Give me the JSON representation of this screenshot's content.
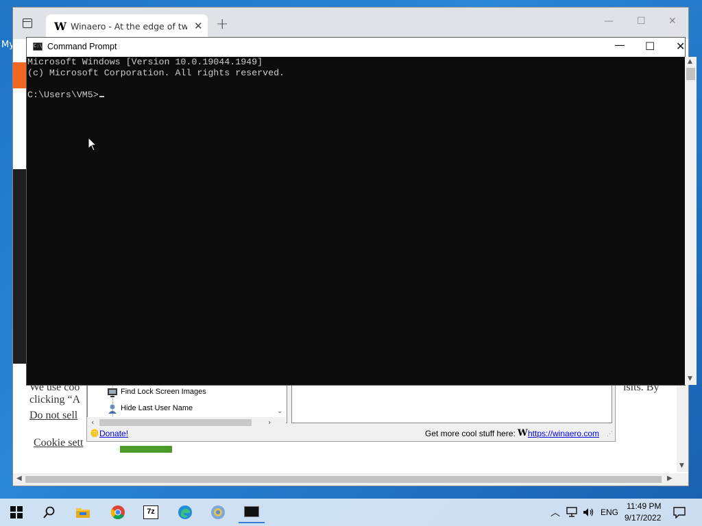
{
  "desktop": {
    "icon_label_partial": "My"
  },
  "browser": {
    "tab": {
      "title": "Winaero - At the edge of tweaki",
      "favicon_letter": "W"
    },
    "controls": {
      "minimize": "—",
      "maximize": "☐",
      "close": "✕",
      "new_tab": "+"
    },
    "page": {
      "cookie_line1_left": "We use coo",
      "cookie_line1_right": "isits. By",
      "cookie_line2": "clicking “A",
      "do_not_sell": "Do not sell",
      "cookie_settings": "Cookie sett"
    }
  },
  "tweaker": {
    "tree_items": [
      {
        "label": "Find Lock Screen Images",
        "icon": "monitor-icon"
      },
      {
        "label": "Hide Last User Name",
        "icon": "user-icon"
      }
    ],
    "status": {
      "donate": "Donate!",
      "more_text": "Get more cool stuff here:",
      "brand_letter": "W",
      "url": "https://winaero.com"
    }
  },
  "cmd": {
    "title": "Command Prompt",
    "lines": [
      "Microsoft Windows [Version 10.0.19044.1949]",
      "(c) Microsoft Corporation. All rights reserved.",
      "",
      "C:\\Users\\VM5>"
    ]
  },
  "taskbar": {
    "apps": [
      "start-icon",
      "search-icon",
      "file-explorer-icon",
      "chrome-icon",
      "7zip-icon",
      "edge-icon",
      "chromium-icon",
      "cmd-icon"
    ],
    "tray": {
      "language": "ENG",
      "time": "11:49 PM",
      "date": "9/17/2022"
    },
    "seven_zip_label": "7z"
  },
  "colors": {
    "accent_orange": "#f26522",
    "console_bg": "#0c0c0c",
    "console_fg": "#cccccc",
    "link": "#0000ee"
  }
}
